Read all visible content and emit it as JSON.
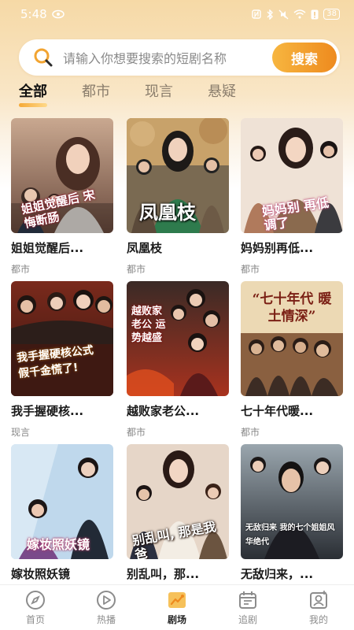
{
  "status_bar": {
    "time": "5:48",
    "battery": "38"
  },
  "search": {
    "placeholder": "请输入你想要搜索的短剧名称",
    "button": "搜索"
  },
  "tabs": [
    {
      "label": "全部",
      "active": true
    },
    {
      "label": "都市",
      "active": false
    },
    {
      "label": "现言",
      "active": false
    },
    {
      "label": "悬疑",
      "active": false
    }
  ],
  "dramas": [
    {
      "title": "姐姐觉醒后...",
      "genre": "都市",
      "poster_text": "姐姐觉醒后 宋悔断肠"
    },
    {
      "title": "凤凰枝",
      "genre": "都市",
      "poster_text": "凤凰枝"
    },
    {
      "title": "妈妈别再低...",
      "genre": "都市",
      "poster_text": "妈妈别 再低调了"
    },
    {
      "title": "我手握硬核...",
      "genre": "现言",
      "poster_text": "我手握硬核公式 假千金慌了!"
    },
    {
      "title": "越败家老公...",
      "genre": "都市",
      "poster_text": "越败家 老公 运势越盛"
    },
    {
      "title": "七十年代暖...",
      "genre": "都市",
      "poster_text": "“七十年代 暖土情深”"
    },
    {
      "title": "嫁妆照妖镜",
      "genre": "",
      "poster_text": "嫁妆照妖镜"
    },
    {
      "title": "别乱叫，那...",
      "genre": "",
      "poster_text": "别乱叫, 那是我爸"
    },
    {
      "title": "无敌归来，...",
      "genre": "",
      "poster_text": "无敌归来 我的七个姐姐风华绝代"
    }
  ],
  "bottom_nav": [
    {
      "label": "首页",
      "icon": "compass-icon",
      "active": false
    },
    {
      "label": "热播",
      "icon": "play-icon",
      "active": false
    },
    {
      "label": "剧场",
      "icon": "theater-icon",
      "active": true
    },
    {
      "label": "追剧",
      "icon": "calendar-icon",
      "active": false
    },
    {
      "label": "我的",
      "icon": "profile-icon",
      "active": false
    }
  ],
  "colors": {
    "accent": "#ef8d20",
    "accent_light": "#f7b640"
  }
}
